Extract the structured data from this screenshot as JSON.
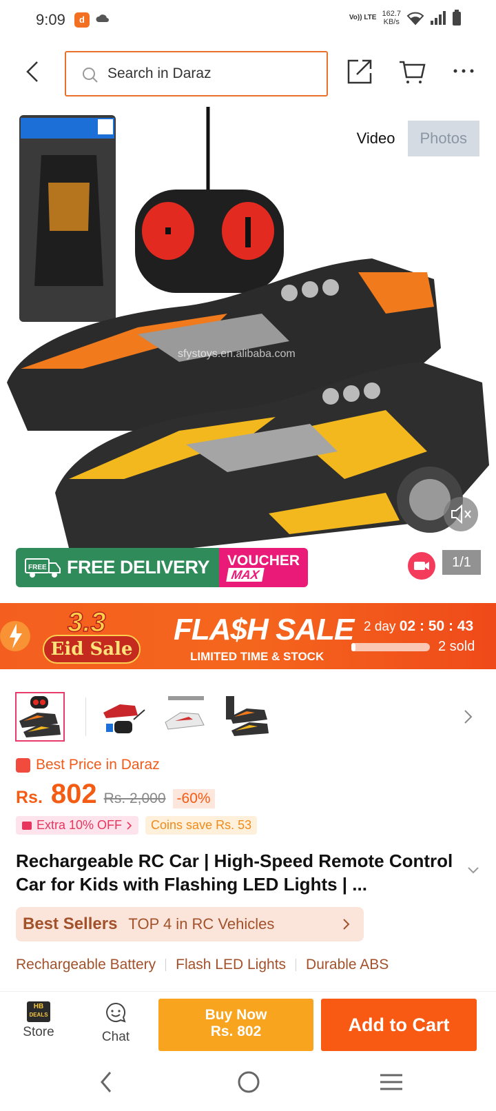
{
  "status": {
    "time": "9:09",
    "network": "Vo)) LTE",
    "speed_value": "162.7",
    "speed_unit": "KB/s"
  },
  "header": {
    "search_placeholder": "Search in Daraz"
  },
  "hero": {
    "tabs": [
      {
        "label": "Video",
        "active": false
      },
      {
        "label": "Photos",
        "active": true
      }
    ],
    "watermark": "sfystoys.en.alibaba.com",
    "free_badge_small": "FREE",
    "free_delivery": "FREE DELIVERY",
    "voucher_line1": "VOUCHER",
    "voucher_line2": "MAX",
    "media_counter": "1/1"
  },
  "flash_sale": {
    "eid_number": "3.3",
    "eid_label": "Eid Sale",
    "title": "FLA$H SALE",
    "subtitle": "LIMITED TIME & STOCK",
    "timer_days": "2 day",
    "timer_clock": "02 : 50 : 43",
    "sold": "2 sold",
    "sold_progress": 0.05
  },
  "product": {
    "best_price_label": "Best Price in Daraz",
    "currency": "Rs.",
    "price": "802",
    "original_price": "Rs. 2,000",
    "discount": "-60%",
    "extra_off": "Extra 10% OFF",
    "coins_save": "Coins save Rs. 53",
    "title": "Rechargeable RC Car | High-Speed Remote Control Car for Kids with Flashing LED Lights | ...",
    "best_sellers_label": "Best Sellers",
    "best_sellers_rank": "TOP 4 in RC Vehicles",
    "features": [
      "Rechargeable Battery",
      "Flash LED Lights",
      "Durable ABS"
    ]
  },
  "bottom_bar": {
    "store_logo_line1": "HB",
    "store_logo_line2": "DEALS",
    "store_label": "Store",
    "chat_label": "Chat",
    "buy_now_label": "Buy Now",
    "buy_now_price": "Rs. 802",
    "add_to_cart_label": "Add to Cart"
  },
  "colors": {
    "brand_orange": "#f85a13",
    "buy_now": "#f9a41f",
    "price": "#f45c14",
    "search_border": "#e8702a"
  }
}
